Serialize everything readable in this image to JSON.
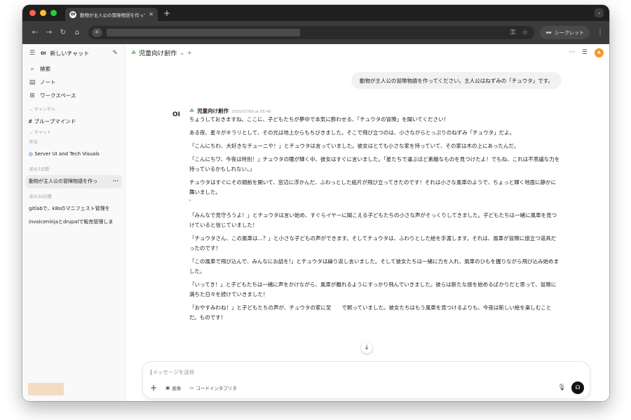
{
  "browser": {
    "tab_title": "動物が主人公の冒険物語を作って ×",
    "tab_title_text": "動物が主人公の冒険物語を作って",
    "incognito_label": "シークレット"
  },
  "sidebar": {
    "new_chat": "新しいチャット",
    "logo": "OI",
    "items": [
      {
        "label": "検索"
      },
      {
        "label": "ノート"
      },
      {
        "label": "ワークスペース"
      }
    ],
    "channels_label": "チャンネル",
    "channel": "# ブループマインド",
    "chats_label": "チャット",
    "today_label": "昨日",
    "today_chat": "Server UI and Tech Visuals",
    "week_label": "前の7日間",
    "week_chat": "動物が主人公の冒険物語を作っ",
    "month_label": "前の30日間",
    "month_chats": [
      "gitlabで、k8sのマニフェスト管理を",
      "invoiceninjaとdrupalで販売管理しま"
    ]
  },
  "main": {
    "model_name": "児童向け創作",
    "user_avatar": "A",
    "user_message": "動物が主人公の冒険物語を作ってください。主人公はねずみの「チュウタ」です。",
    "ai_logo": "OI",
    "ai_name": "児童向け創作",
    "ai_time": "2025/07/09 at 05:40",
    "ai_paragraphs": [
      "ちょうしておきますね。ここに、子どもたちが夢中で本気に酔わせる、「チュウタの冒険」を聞いてください！",
      "ある夜、星々がキラリとして、その光は地上からもちびきました。そこで飛び立つのは、小さながらとっぷりのねずみ「チュウタ」だよ。",
      "「こんにちわ、大好きなチューニや！」とチュウタは言っていました。彼女はとても小さな家を持っていて、その家は木の上にあったんだ。",
      "「こんにちワ、今夜は特別！」チュウタの瞳が輝く中、彼女はすぐに言いました。「星たちで運ぶほど素敵なものを見つけたよ！でもね、これは不思議な力を持っているかもしれない。」",
      "チュウタはすぐにその頭前を開いて、窓辺に浮かんだ、ふわっとした紙片が飛び立ってきたのです！それは小さな風車のようで、ちょっと輝く地面に静かに舞いました。\n'",
      "「みんなで見守ろうよ！」とチュウタは言い始め、すぐらイヤーに聞こえる子どもたちの小さな声がそっくりしてきました。子どもたちは一緒に風車を見つけていると信じていました！",
      "「チュウタさん、この風車は…？」と小さな子どもの声ができます。そしてチュウタは、ふわりとした絵を手渡します。それは、風車が冒険に旅立つ道具だったのです！",
      "「この風車で飛び込んで、みんなにお話を!」とチュウタは繰り返し言いました。そして彼女たちは一緒に力を入れ、風車のひもを握りながら飛び込み始めました。",
      "「いってき！」と子どもたちは一緒に声をかけながら、風車が離れるようにすっかり飛んでいきました。彼らは新たな旅を始めるばかりだと思って、冒険に満ちた日々を続けていきました！",
      "「おやすみわね！」と子どもたちの声が、チュウタの家に至　　で黙っていました。彼女たちはもう風車を見つけるよりも、今夜は新しい絵を楽しむことだ。ものです！"
    ]
  },
  "composer": {
    "placeholder": "メッセージを送信",
    "image_label": "画像",
    "code_label": "コードインタプリタ"
  }
}
